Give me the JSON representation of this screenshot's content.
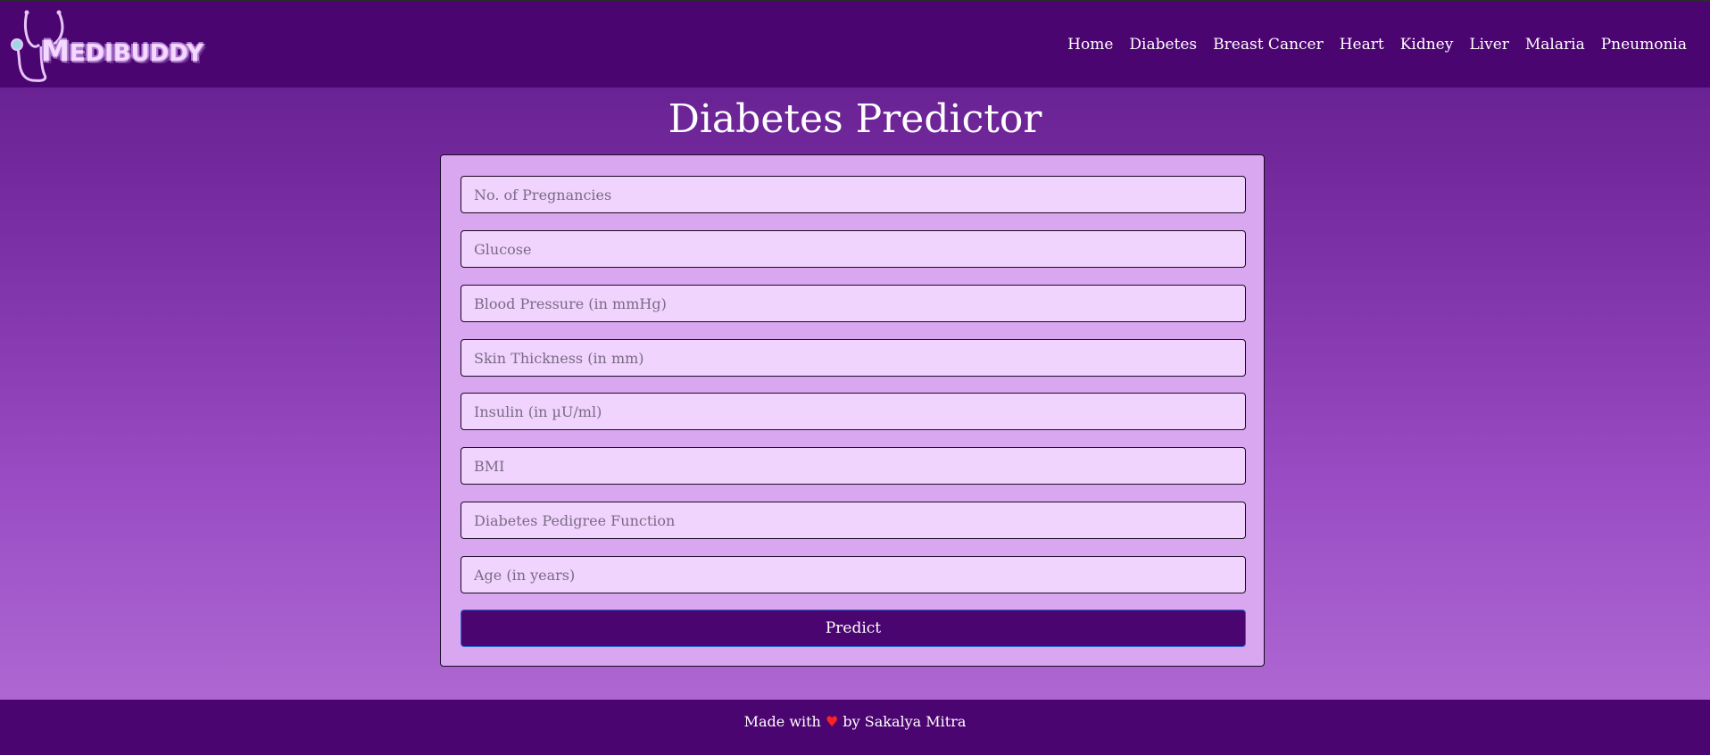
{
  "brand": {
    "logo_text_first": "M",
    "logo_text_rest": "EDIBUDDY"
  },
  "nav": {
    "items": [
      "Home",
      "Diabetes",
      "Breast Cancer",
      "Heart",
      "Kidney",
      "Liver",
      "Malaria",
      "Pneumonia"
    ]
  },
  "page": {
    "title": "Diabetes Predictor"
  },
  "form": {
    "fields": [
      {
        "placeholder": "No. of Pregnancies",
        "value": ""
      },
      {
        "placeholder": "Glucose",
        "value": ""
      },
      {
        "placeholder": "Blood Pressure (in mmHg)",
        "value": ""
      },
      {
        "placeholder": "Skin Thickness (in mm)",
        "value": ""
      },
      {
        "placeholder": "Insulin (in µU/ml)",
        "value": ""
      },
      {
        "placeholder": "BMI",
        "value": ""
      },
      {
        "placeholder": "Diabetes Pedigree Function",
        "value": ""
      },
      {
        "placeholder": "Age (in years)",
        "value": ""
      }
    ],
    "submit_label": "Predict"
  },
  "footer": {
    "prefix": "Made with",
    "heart": "♥",
    "suffix": "by Sakalya Mitra"
  },
  "colors": {
    "navbar": "#4b0570",
    "card": "#d9a6f0",
    "field": "#f0d4fd",
    "button": "#4b0570",
    "heart": "#ff2222"
  },
  "icons": {
    "logo": "stethoscope-icon"
  }
}
